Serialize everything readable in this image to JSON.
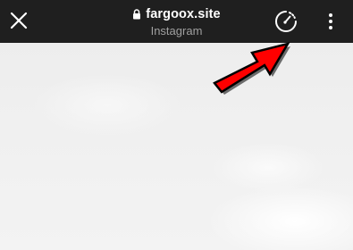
{
  "browser": {
    "url": "fargoox.site",
    "site_name": "Instagram",
    "icons": {
      "close": "close-icon",
      "lock": "lock-icon",
      "speed": "speedometer-icon",
      "menu": "more-vertical-icon"
    }
  },
  "annotation": {
    "arrow_color": "#ff0000",
    "points_to": "speedometer-icon"
  },
  "colors": {
    "toolbar_bg": "#1f1f1f",
    "toolbar_text": "#ffffff",
    "subtitle_text": "#a0a0a0",
    "content_bg": "#f2f2f2"
  }
}
